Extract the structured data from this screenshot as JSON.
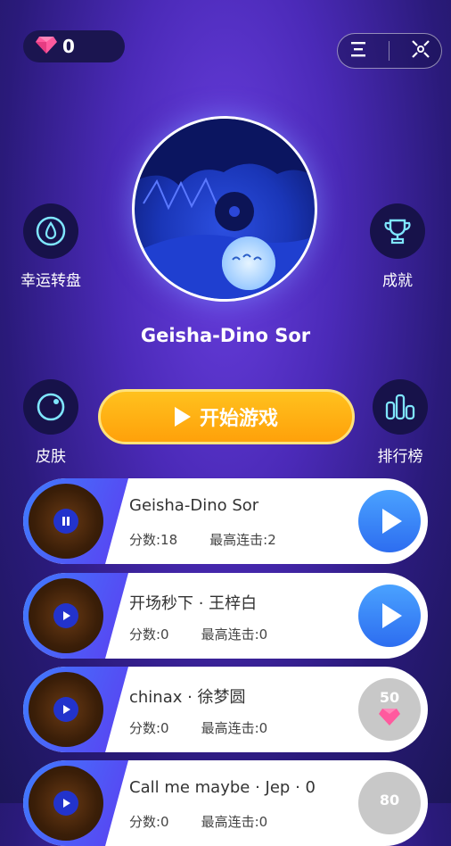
{
  "header": {
    "gem_count": "0"
  },
  "now_playing": {
    "title": "Geisha-Dino Sor"
  },
  "features": {
    "lucky_wheel": "幸运转盘",
    "achievements": "成就",
    "skins": "皮肤",
    "leaderboard": "排行榜"
  },
  "start_button": {
    "label": "开始游戏"
  },
  "songs": [
    {
      "name": "Geisha-Dino Sor",
      "score_label": "分数:18",
      "combo_label": "最高连击:2",
      "state": "playing"
    },
    {
      "name": "开场秒下 · 王梓白",
      "score_label": "分数:0",
      "combo_label": "最高连击:0",
      "state": "unlocked"
    },
    {
      "name": "chinax · 徐梦圆",
      "score_label": "分数:0",
      "combo_label": "最高连击:0",
      "state": "locked",
      "price": "50"
    },
    {
      "name": "Call me maybe · Jep · 0",
      "score_label": "分数:0",
      "combo_label": "最高连击:0",
      "state": "locked",
      "price": "80"
    }
  ],
  "colors": {
    "accent_gold": "#ffb010",
    "play_blue": "#3a86ff",
    "bg_purple": "#4b2ab8"
  }
}
